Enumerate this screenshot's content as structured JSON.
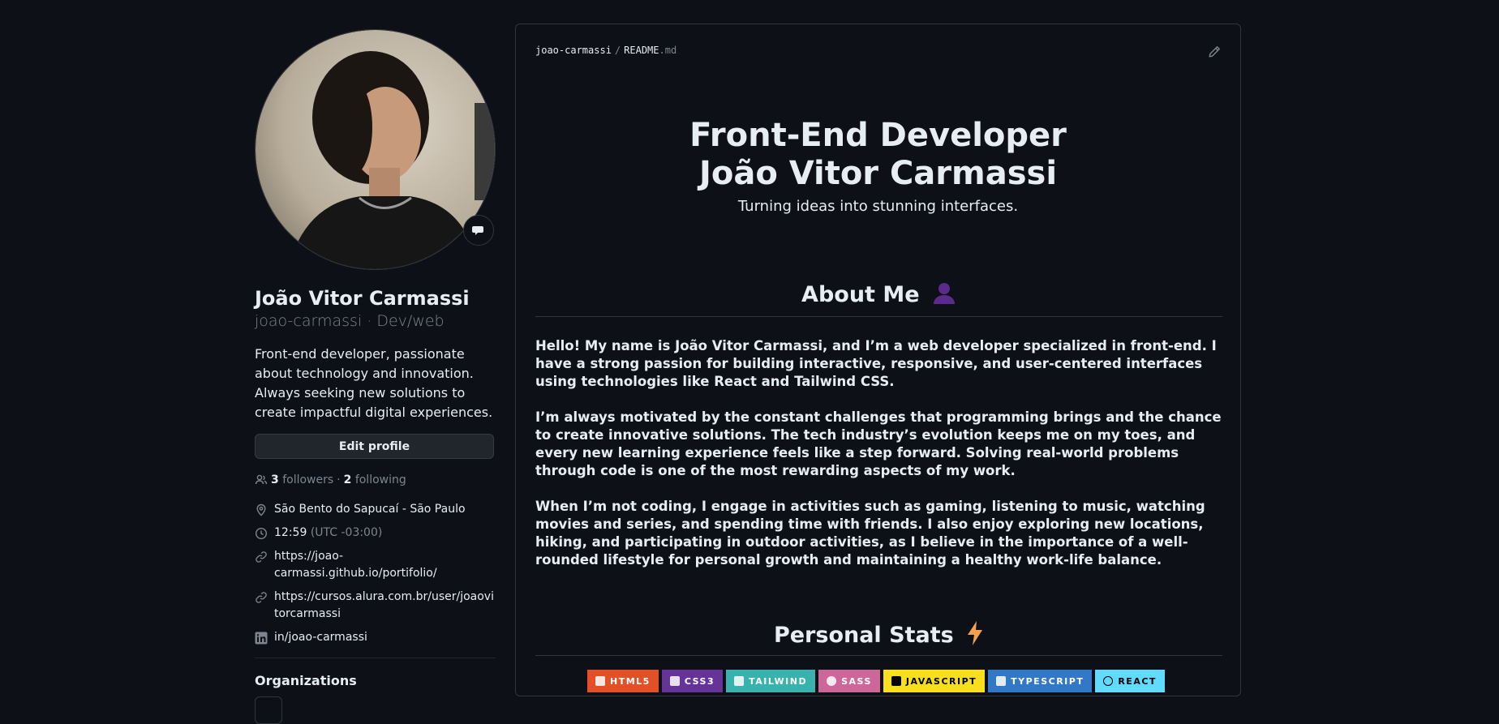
{
  "profile": {
    "full_name": "João Vitor Carmassi",
    "login": "joao-carmassi",
    "pronouns_sep": "·",
    "pronouns": "Dev/web",
    "bio": "Front-end developer, passionate about technology and innovation. Always seeking new solutions to create impactful digital experiences.",
    "edit_label": "Edit profile",
    "followers_count": "3",
    "followers_label": "followers",
    "dot": "·",
    "following_count": "2",
    "following_label": "following",
    "location": "São Bento do Sapucaí - São Paulo",
    "time": "12:59",
    "timezone": "(UTC -03:00)",
    "link1": "https://joao-carmassi.github.io/portifolio/",
    "link2": "https://cursos.alura.com.br/user/joaovitorcarmassi",
    "linkedin": "in/joao-carmassi",
    "organizations_title": "Organizations"
  },
  "readme": {
    "path_owner": "joao-carmassi",
    "path_sep": "/",
    "path_file": "README",
    "path_ext": ".md",
    "hero_line1": "Front-End Developer",
    "hero_line2": "João Vitor Carmassi",
    "tagline": "Turning ideas into stunning interfaces.",
    "about_title": "About Me",
    "about_p1": "Hello! My name is João Vitor Carmassi, and I’m a web developer specialized in front-end. I have a strong passion for building interactive, responsive, and user-centered interfaces using technologies like React and Tailwind CSS.",
    "about_p2": "I’m always motivated by the constant challenges that programming brings and the chance to create innovative solutions. The tech industry’s evolution keeps me on my toes, and every new learning experience feels like a step forward. Solving real-world problems through code is one of the most rewarding aspects of my work.",
    "about_p3": "When I’m not coding, I engage in activities such as gaming, listening to music, watching movies and series, and spending time with friends. I also enjoy exploring new locations, hiking, and participating in outdoor activities, as I believe in the importance of a well-rounded lifestyle for personal growth and maintaining a healthy work-life balance.",
    "stats_title": "Personal Stats",
    "badges": [
      {
        "label": "HTML5",
        "color": "#e34f26"
      },
      {
        "label": "CSS3",
        "color": "#663399"
      },
      {
        "label": "TAILWIND",
        "color": "#38b2ac"
      },
      {
        "label": "SASS",
        "color": "#cd6799"
      },
      {
        "label": "JAVASCRIPT",
        "color": "#f7df1e"
      },
      {
        "label": "TYPESCRIPT",
        "color": "#3178c6"
      },
      {
        "label": "REACT",
        "color": "#61dafb"
      }
    ]
  },
  "icons": [
    "smiley-status-icon",
    "people-icon",
    "location-icon",
    "clock-icon",
    "link-icon",
    "linkedin-icon",
    "pencil-icon",
    "bust-icon",
    "lightning-icon"
  ],
  "colors": {
    "background": "#0d1117",
    "text": "#e6edf3",
    "muted": "#7d8590",
    "border": "#30363d"
  }
}
